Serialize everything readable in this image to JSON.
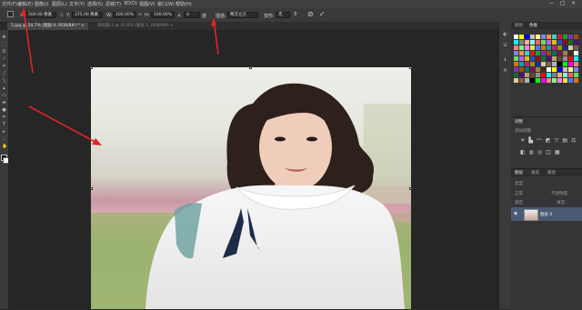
{
  "menu": [
    "文件(F)",
    "编辑(E)",
    "图像(I)",
    "图层(L)",
    "文字(Y)",
    "选择(S)",
    "滤镜(T)",
    "3D(D)",
    "视图(V)",
    "窗口(W)",
    "帮助(H)"
  ],
  "options": {
    "x_label": "X:",
    "x_value": "500.00 像素",
    "y_label": "Y:",
    "y_value": "375.00 像素",
    "w_label": "W:",
    "w_value": "100.00%",
    "h_label": "H:",
    "h_value": "100.00%",
    "angle_label": "角度:",
    "angle_value": "0",
    "hskew_label": "度",
    "interp_label": "插值:",
    "interp_value": "两次立方",
    "warp_label": "变形:",
    "warp_value": "无",
    "cancel_icon": "⊘",
    "commit_icon": "✓"
  },
  "tabs": [
    {
      "label": "1.jpg @ 54.7% (图层 0, RGB/8#) *",
      "close": "×"
    },
    {
      "label": "未标题-1 @ 41.6% (图层 1, RGB/8#)",
      "close": "×"
    }
  ],
  "color_panel": {
    "tabs": [
      "颜色",
      "色板"
    ],
    "active": 1
  },
  "adjust_panel": {
    "title": "调整",
    "subtitle": "添加调整"
  },
  "layers_panel": {
    "tabs": [
      "图层",
      "通道",
      "路径"
    ],
    "kind": "类型",
    "blend": "正常",
    "opacity_label": "不透明度:",
    "lock_label": "锁定:",
    "fill_label": "填充:",
    "layer_name": "图层 0",
    "eye_icon": "👁"
  },
  "colors": {
    "swatches": [
      "#ffffff",
      "#000000",
      "#ff0000",
      "#ffff00",
      "#00ff00",
      "#00ffff",
      "#0000ff",
      "#ff00ff",
      "#808080",
      "#c0c0c0",
      "#ff8080",
      "#ffb380",
      "#ffff80",
      "#80ff80",
      "#80ffff",
      "#8080ff",
      "#ff80ff",
      "#ff6060",
      "#ff9040",
      "#ffe040",
      "#60e060",
      "#40d0d0",
      "#4080ff",
      "#c060ff",
      "#d02020",
      "#e07010",
      "#e0c000",
      "#20a030",
      "#10a0a0",
      "#2050c0",
      "#8030c0",
      "#c02080",
      "#901010",
      "#a05000",
      "#a09000",
      "#107020",
      "#007070",
      "#103090",
      "#501080",
      "#801050",
      "#e0c8a0",
      "#c0a070",
      "#a08050",
      "#806040",
      "#604830",
      "#403020",
      "#b0b0b0",
      "#909090"
    ]
  }
}
